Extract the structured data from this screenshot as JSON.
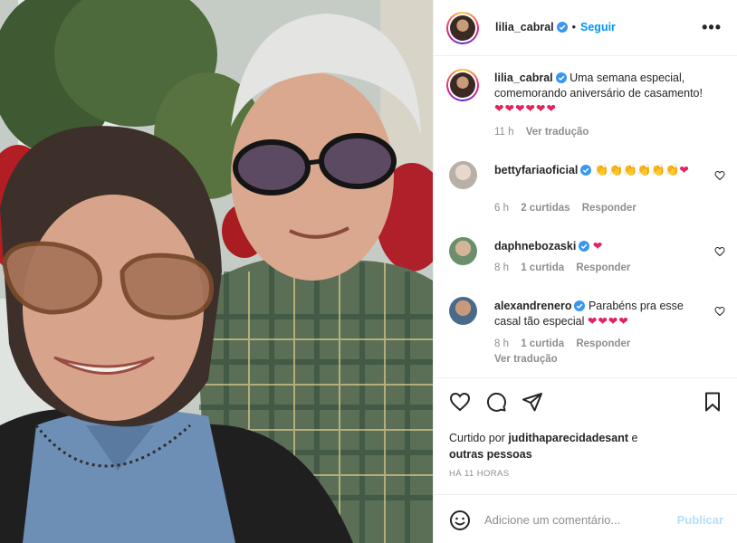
{
  "post": {
    "author": "lilia_cabral",
    "follow_label": "Seguir",
    "separator": "•",
    "more_label": "•••",
    "photo_alt": "selfie"
  },
  "caption": {
    "username": "lilia_cabral",
    "text": "Uma semana especial, comemorando aniversário de casamento!",
    "emojis": "❤❤❤❤❤❤",
    "age": "11 h",
    "translate": "Ver tradução"
  },
  "comments": [
    {
      "username": "bettyfariaoficial",
      "text": "",
      "emojis_clap": "👏👏👏👏👏👏",
      "emojis_heart": "❤",
      "age": "6 h",
      "likes": "2 curtidas",
      "reply": "Responder"
    },
    {
      "username": "daphnebozaski",
      "text": "",
      "emojis_heart": "❤",
      "age": "8 h",
      "likes": "1 curtida",
      "reply": "Responder"
    },
    {
      "username": "alexandrenero",
      "text": "Parabéns pra esse casal tão especial",
      "emojis_heart": "❤❤❤❤",
      "age": "8 h",
      "likes": "1 curtida",
      "reply": "Responder",
      "translate": "Ver tradução"
    }
  ],
  "likes": {
    "prefix": "Curtido por",
    "user": "judithaparecidadesant",
    "mid": "e",
    "others": "outras pessoas"
  },
  "timestamp": "HÁ 11 HORAS",
  "add_comment": {
    "placeholder": "Adicione um comentário...",
    "publish_label": "Publicar"
  },
  "icons": {
    "verified": "verified-badge-icon",
    "heart": "heart-icon",
    "comment": "comment-icon",
    "share": "share-icon",
    "save": "bookmark-icon",
    "emoji": "emoji-icon",
    "more": "more-icon"
  },
  "colors": {
    "accent": "#0095f6",
    "verified": "#3897f0",
    "muted": "#8e8e8e",
    "publish_disabled": "#b2dffc",
    "heart_red": "#e0245e"
  }
}
